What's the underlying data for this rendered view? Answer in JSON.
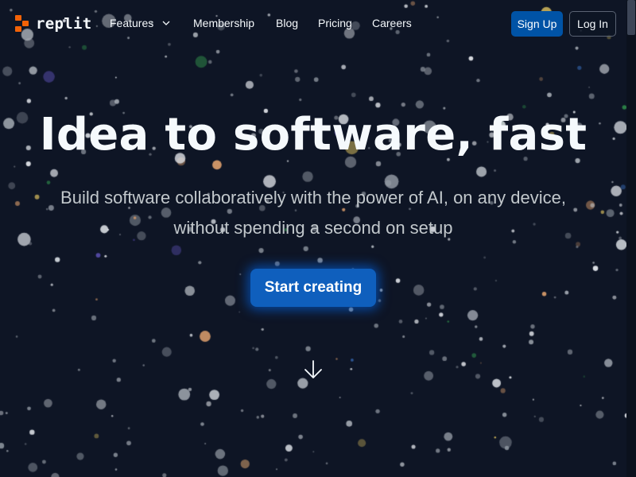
{
  "brand": {
    "name": "replit",
    "logo_color": "#f26207"
  },
  "nav": {
    "features_label": "Features",
    "membership_label": "Membership",
    "blog_label": "Blog",
    "pricing_label": "Pricing",
    "careers_label": "Careers"
  },
  "auth": {
    "signup_label": "Sign Up",
    "login_label": "Log In"
  },
  "hero": {
    "title": "Idea to software, fast",
    "subtitle": "Build software collaboratively with the power of AI, on any device, without spending a second on setup",
    "cta_label": "Start creating"
  },
  "icons": {
    "features_dropdown": "chevron-down-icon",
    "scroll_hint": "arrow-down-icon"
  },
  "colors": {
    "background": "#0e1525",
    "accent_blue": "#0053a6",
    "cta_blue": "#0f5fbd",
    "text_primary": "#f5f9fc",
    "text_secondary": "#c2c8cc"
  }
}
